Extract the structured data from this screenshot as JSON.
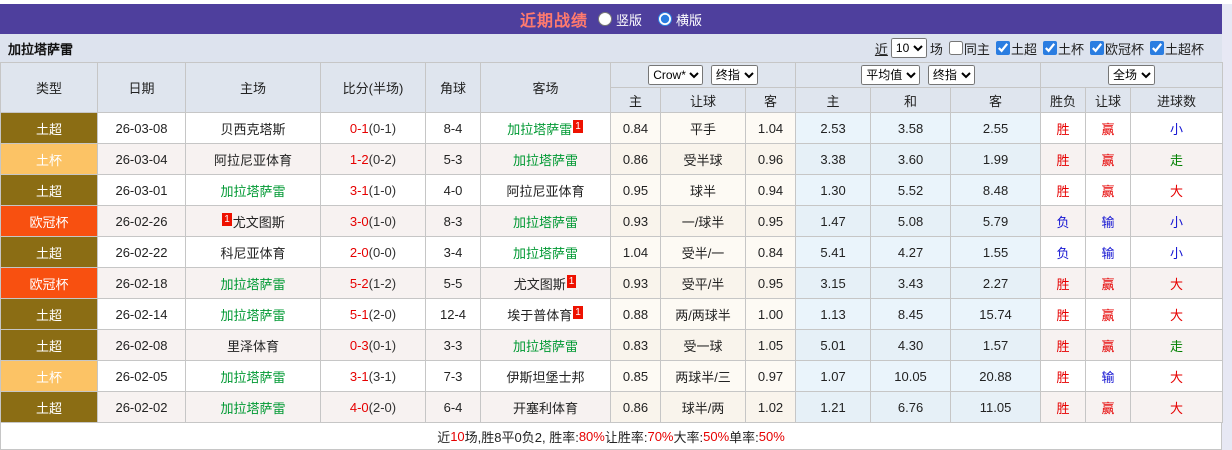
{
  "title_bar": {
    "title": "近期战绩",
    "radio_vertical": {
      "label": "竖版",
      "checked": false
    },
    "radio_horizontal": {
      "label": "横版",
      "checked": true
    }
  },
  "filter_bar": {
    "team": "加拉塔萨雷",
    "near_label": "近",
    "count_value": "10",
    "field_label": "场",
    "same_home": {
      "label": "同主",
      "checked": false
    },
    "leagues": [
      {
        "label": "土超",
        "checked": true
      },
      {
        "label": "土杯",
        "checked": true
      },
      {
        "label": "欧冠杯",
        "checked": true
      },
      {
        "label": "土超杯",
        "checked": true
      }
    ]
  },
  "table": {
    "league_colors": {
      "土超": "#8b6d14",
      "土杯": "#fcc365",
      "欧冠杯": "#f85010"
    },
    "headers": {
      "type": "类型",
      "date": "日期",
      "home": "主场",
      "score": "比分(半场)",
      "corner": "角球",
      "away": "客场",
      "bookmaker_select": "Crow*",
      "bookmaker_final_select": "终指",
      "avg_select": "平均值",
      "avg_final_select": "终指",
      "scope_select": "全场",
      "odds_home": "主",
      "odds_line": "让球",
      "odds_away": "客",
      "avg_home": "主",
      "avg_draw": "和",
      "avg_away": "客",
      "res_wl": "胜负",
      "res_let": "让球",
      "res_goal": "进球数"
    },
    "rows": [
      {
        "type": "土超",
        "date": "26-03-08",
        "home": {
          "name": "贝西克塔斯",
          "green": false,
          "badge": null,
          "badge_pos": null
        },
        "score": {
          "ft": "0-1",
          "ht": "(0-1)"
        },
        "corner": "8-4",
        "away": {
          "name": "加拉塔萨雷",
          "green": true,
          "badge": "1",
          "badge_pos": "after"
        },
        "odds_home": "0.84",
        "odds_line": "平手",
        "odds_away": "1.04",
        "avg_home": "2.53",
        "avg_draw": "3.58",
        "avg_away": "2.55",
        "res_wl": {
          "text": "胜",
          "color": "red"
        },
        "res_let": {
          "text": "赢",
          "color": "red"
        },
        "res_goal": {
          "text": "小",
          "color": "blue"
        }
      },
      {
        "type": "土杯",
        "date": "26-03-04",
        "home": {
          "name": "阿拉尼亚体育",
          "green": false,
          "badge": null,
          "badge_pos": null
        },
        "score": {
          "ft": "1-2",
          "ht": "(0-2)"
        },
        "corner": "5-3",
        "away": {
          "name": "加拉塔萨雷",
          "green": true,
          "badge": null,
          "badge_pos": null
        },
        "odds_home": "0.86",
        "odds_line": "受半球",
        "odds_away": "0.96",
        "avg_home": "3.38",
        "avg_draw": "3.60",
        "avg_away": "1.99",
        "res_wl": {
          "text": "胜",
          "color": "red"
        },
        "res_let": {
          "text": "赢",
          "color": "red"
        },
        "res_goal": {
          "text": "走",
          "color": "green"
        }
      },
      {
        "type": "土超",
        "date": "26-03-01",
        "home": {
          "name": "加拉塔萨雷",
          "green": true,
          "badge": null,
          "badge_pos": null
        },
        "score": {
          "ft": "3-1",
          "ht": "(1-0)"
        },
        "corner": "4-0",
        "away": {
          "name": "阿拉尼亚体育",
          "green": false,
          "badge": null,
          "badge_pos": null
        },
        "odds_home": "0.95",
        "odds_line": "球半",
        "odds_away": "0.94",
        "avg_home": "1.30",
        "avg_draw": "5.52",
        "avg_away": "8.48",
        "res_wl": {
          "text": "胜",
          "color": "red"
        },
        "res_let": {
          "text": "赢",
          "color": "red"
        },
        "res_goal": {
          "text": "大",
          "color": "red"
        }
      },
      {
        "type": "欧冠杯",
        "date": "26-02-26",
        "home": {
          "name": "尤文图斯",
          "green": false,
          "badge": "1",
          "badge_pos": "before"
        },
        "score": {
          "ft": "3-0",
          "ht": "(1-0)"
        },
        "corner": "8-3",
        "away": {
          "name": "加拉塔萨雷",
          "green": true,
          "badge": null,
          "badge_pos": null
        },
        "odds_home": "0.93",
        "odds_line": "一/球半",
        "odds_away": "0.95",
        "avg_home": "1.47",
        "avg_draw": "5.08",
        "avg_away": "5.79",
        "res_wl": {
          "text": "负",
          "color": "blue"
        },
        "res_let": {
          "text": "输",
          "color": "blue"
        },
        "res_goal": {
          "text": "小",
          "color": "blue"
        }
      },
      {
        "type": "土超",
        "date": "26-02-22",
        "home": {
          "name": "科尼亚体育",
          "green": false,
          "badge": null,
          "badge_pos": null
        },
        "score": {
          "ft": "2-0",
          "ht": "(0-0)"
        },
        "corner": "3-4",
        "away": {
          "name": "加拉塔萨雷",
          "green": true,
          "badge": null,
          "badge_pos": null
        },
        "odds_home": "1.04",
        "odds_line": "受半/一",
        "odds_away": "0.84",
        "avg_home": "5.41",
        "avg_draw": "4.27",
        "avg_away": "1.55",
        "res_wl": {
          "text": "负",
          "color": "blue"
        },
        "res_let": {
          "text": "输",
          "color": "blue"
        },
        "res_goal": {
          "text": "小",
          "color": "blue"
        }
      },
      {
        "type": "欧冠杯",
        "date": "26-02-18",
        "home": {
          "name": "加拉塔萨雷",
          "green": true,
          "badge": null,
          "badge_pos": null
        },
        "score": {
          "ft": "5-2",
          "ht": "(1-2)"
        },
        "corner": "5-5",
        "away": {
          "name": "尤文图斯",
          "green": false,
          "badge": "1",
          "badge_pos": "after"
        },
        "odds_home": "0.93",
        "odds_line": "受平/半",
        "odds_away": "0.95",
        "avg_home": "3.15",
        "avg_draw": "3.43",
        "avg_away": "2.27",
        "res_wl": {
          "text": "胜",
          "color": "red"
        },
        "res_let": {
          "text": "赢",
          "color": "red"
        },
        "res_goal": {
          "text": "大",
          "color": "red"
        }
      },
      {
        "type": "土超",
        "date": "26-02-14",
        "home": {
          "name": "加拉塔萨雷",
          "green": true,
          "badge": null,
          "badge_pos": null
        },
        "score": {
          "ft": "5-1",
          "ht": "(2-0)"
        },
        "corner": "12-4",
        "away": {
          "name": "埃于普体育",
          "green": false,
          "badge": "1",
          "badge_pos": "after"
        },
        "odds_home": "0.88",
        "odds_line": "两/两球半",
        "odds_away": "1.00",
        "avg_home": "1.13",
        "avg_draw": "8.45",
        "avg_away": "15.74",
        "res_wl": {
          "text": "胜",
          "color": "red"
        },
        "res_let": {
          "text": "赢",
          "color": "red"
        },
        "res_goal": {
          "text": "大",
          "color": "red"
        }
      },
      {
        "type": "土超",
        "date": "26-02-08",
        "home": {
          "name": "里泽体育",
          "green": false,
          "badge": null,
          "badge_pos": null
        },
        "score": {
          "ft": "0-3",
          "ht": "(0-1)"
        },
        "corner": "3-3",
        "away": {
          "name": "加拉塔萨雷",
          "green": true,
          "badge": null,
          "badge_pos": null
        },
        "odds_home": "0.83",
        "odds_line": "受一球",
        "odds_away": "1.05",
        "avg_home": "5.01",
        "avg_draw": "4.30",
        "avg_away": "1.57",
        "res_wl": {
          "text": "胜",
          "color": "red"
        },
        "res_let": {
          "text": "赢",
          "color": "red"
        },
        "res_goal": {
          "text": "走",
          "color": "green"
        }
      },
      {
        "type": "土杯",
        "date": "26-02-05",
        "home": {
          "name": "加拉塔萨雷",
          "green": true,
          "badge": null,
          "badge_pos": null
        },
        "score": {
          "ft": "3-1",
          "ht": "(3-1)"
        },
        "corner": "7-3",
        "away": {
          "name": "伊斯坦堡士邦",
          "green": false,
          "badge": null,
          "badge_pos": null
        },
        "odds_home": "0.85",
        "odds_line": "两球半/三",
        "odds_away": "0.97",
        "avg_home": "1.07",
        "avg_draw": "10.05",
        "avg_away": "20.88",
        "res_wl": {
          "text": "胜",
          "color": "red"
        },
        "res_let": {
          "text": "输",
          "color": "blue"
        },
        "res_goal": {
          "text": "大",
          "color": "red"
        }
      },
      {
        "type": "土超",
        "date": "26-02-02",
        "home": {
          "name": "加拉塔萨雷",
          "green": true,
          "badge": null,
          "badge_pos": null
        },
        "score": {
          "ft": "4-0",
          "ht": "(2-0)"
        },
        "corner": "6-4",
        "away": {
          "name": "开塞利体育",
          "green": false,
          "badge": null,
          "badge_pos": null
        },
        "odds_home": "0.86",
        "odds_line": "球半/两",
        "odds_away": "1.02",
        "avg_home": "1.21",
        "avg_draw": "6.76",
        "avg_away": "11.05",
        "res_wl": {
          "text": "胜",
          "color": "red"
        },
        "res_let": {
          "text": "赢",
          "color": "red"
        },
        "res_goal": {
          "text": "大",
          "color": "red"
        }
      }
    ]
  },
  "footer": {
    "segments": [
      {
        "text": "近",
        "color": "black"
      },
      {
        "text": "10",
        "color": "red"
      },
      {
        "text": "场,胜8平0负2, 胜率:",
        "color": "black"
      },
      {
        "text": "80%",
        "color": "red"
      },
      {
        "text": " 让胜率:",
        "color": "black"
      },
      {
        "text": "70%",
        "color": "red"
      },
      {
        "text": " 大率:",
        "color": "black"
      },
      {
        "text": "50%",
        "color": "red"
      },
      {
        "text": " 单率:",
        "color": "black"
      },
      {
        "text": "50%",
        "color": "red"
      }
    ]
  },
  "colors": {
    "title_bar_bg": "#4e3f9d",
    "title_text": "#ff7a6e",
    "filter_bar_bg": "#dde3ee",
    "header_bg": "#dfe5ee",
    "league_tuchao": "#8b6d14",
    "league_tubei": "#fcc365",
    "league_ouguanbei": "#f85010",
    "team_green": "#009933",
    "win_red": "#e60000",
    "lose_blue": "#1414d2",
    "draw_green": "#008000",
    "avg_col_bg": "#eaf4fb",
    "badge_bg": "#ee1100"
  }
}
